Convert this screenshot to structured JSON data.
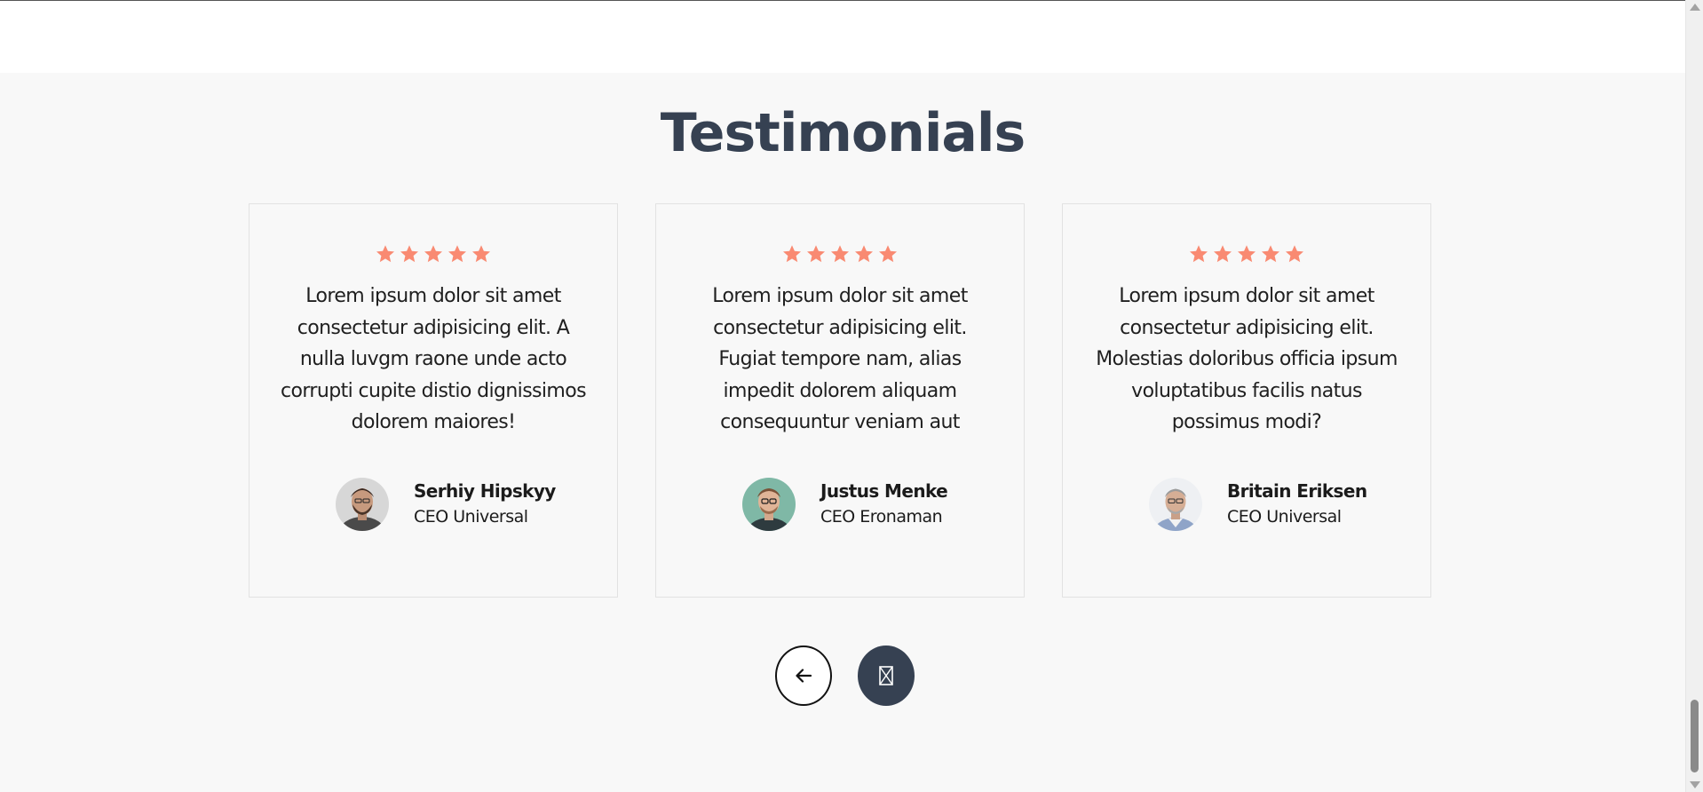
{
  "section": {
    "title": "Testimonials"
  },
  "colors": {
    "heading": "#364152",
    "star": "#f98a72",
    "background": "#f8f8f8",
    "next_button": "#364152"
  },
  "testimonials": [
    {
      "rating": 5,
      "quote": "Lorem ipsum dolor sit amet consectetur adipisicing elit. A nulla luvgm raone unde acto corrupti cupite distio dignissimos dolorem maiores!",
      "name": "Serhiy Hipskyy",
      "role": "CEO Universal",
      "avatar_icon": "person-photo-avatar"
    },
    {
      "rating": 5,
      "quote": "Lorem ipsum dolor sit amet consectetur adipisicing elit. Fugiat tempore nam, alias impedit dolorem aliquam consequuntur veniam aut",
      "name": "Justus Menke",
      "role": "CEO Eronaman",
      "avatar_icon": "person-photo-avatar"
    },
    {
      "rating": 5,
      "quote": "Lorem ipsum dolor sit amet consectetur adipisicing elit. Molestias doloribus officia ipsum voluptatibus facilis natus possimus modi?",
      "name": "Britain Eriksen",
      "role": "CEO Universal",
      "avatar_icon": "person-photo-avatar"
    }
  ],
  "navigation": {
    "prev_icon": "arrow-left-icon",
    "next_icon": "missing-glyph-icon",
    "next_glyph": "⊠"
  }
}
